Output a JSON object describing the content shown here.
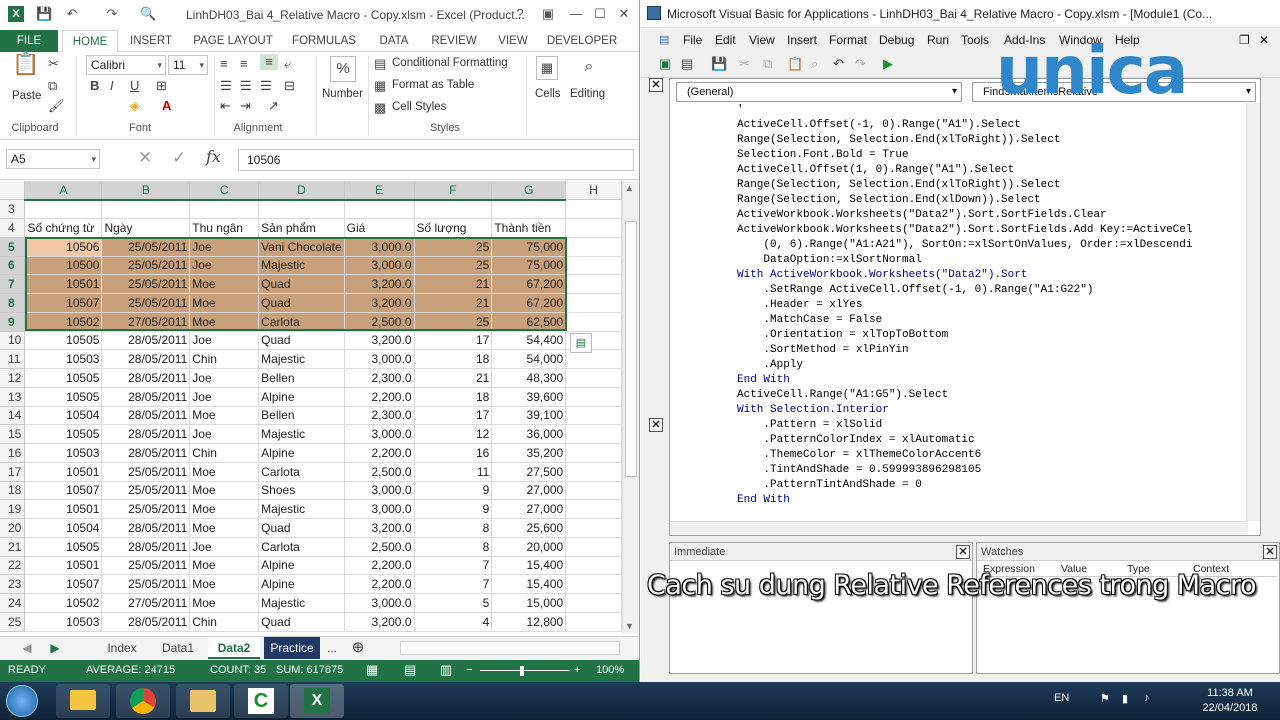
{
  "excel": {
    "title": "LinhDH03_Bai 4_Relative Macro - Copy.xlsm - Excel (Product...",
    "help": "?",
    "tabs": [
      "FILE",
      "HOME",
      "INSERT",
      "PAGE LAYOUT",
      "FORMULAS",
      "DATA",
      "REVIEW",
      "VIEW",
      "DEVELOPER"
    ],
    "ribbon": {
      "paste": "Paste",
      "font_name": "Calibri",
      "font_size": "11",
      "bold": "B",
      "italic": "I",
      "underline": "U",
      "number": "Number",
      "conditional_formatting": "Conditional Formatting",
      "format_as_table": "Format as Table",
      "cell_styles": "Cell Styles",
      "cells": "Cells",
      "editing": "Editing",
      "groups": [
        "Clipboard",
        "Font",
        "Alignment",
        "Styles"
      ]
    },
    "name_box": "A5",
    "formula_value": "10506",
    "fx": "fx",
    "columns": [
      "A",
      "B",
      "C",
      "D",
      "E",
      "F",
      "G",
      "H"
    ],
    "header_row": {
      "row": "4",
      "cells": [
        "Số chứng từ",
        "Ngày",
        "Thu ngân",
        "Sản phẩm",
        "Giá",
        "Số lượng",
        "Thành tiền"
      ]
    },
    "rows": [
      {
        "r": "5",
        "a": "10506",
        "b": "25/05/2011",
        "c": "Joe",
        "d": "Vani Chocolate",
        "e": "3,000.0",
        "f": "25",
        "g": "75,000",
        "hl": true
      },
      {
        "r": "6",
        "a": "10500",
        "b": "25/05/2011",
        "c": "Joe",
        "d": "Majestic",
        "e": "3,000.0",
        "f": "25",
        "g": "75,000",
        "hl": true
      },
      {
        "r": "7",
        "a": "10501",
        "b": "25/05/2011",
        "c": "Moe",
        "d": "Quad",
        "e": "3,200.0",
        "f": "21",
        "g": "67,200",
        "hl": true
      },
      {
        "r": "8",
        "a": "10507",
        "b": "25/05/2011",
        "c": "Moe",
        "d": "Quad",
        "e": "3,200.0",
        "f": "21",
        "g": "67,200",
        "hl": true
      },
      {
        "r": "9",
        "a": "10502",
        "b": "27/05/2011",
        "c": "Moe",
        "d": "Carlota",
        "e": "2,500.0",
        "f": "25",
        "g": "62,500",
        "hl": true
      },
      {
        "r": "10",
        "a": "10505",
        "b": "28/05/2011",
        "c": "Joe",
        "d": "Quad",
        "e": "3,200.0",
        "f": "17",
        "g": "54,400"
      },
      {
        "r": "11",
        "a": "10503",
        "b": "28/05/2011",
        "c": "Chin",
        "d": "Majestic",
        "e": "3,000.0",
        "f": "18",
        "g": "54,000"
      },
      {
        "r": "12",
        "a": "10505",
        "b": "28/05/2011",
        "c": "Joe",
        "d": "Bellen",
        "e": "2,300.0",
        "f": "21",
        "g": "48,300"
      },
      {
        "r": "13",
        "a": "10505",
        "b": "28/05/2011",
        "c": "Joe",
        "d": "Alpine",
        "e": "2,200.0",
        "f": "18",
        "g": "39,600"
      },
      {
        "r": "14",
        "a": "10504",
        "b": "28/05/2011",
        "c": "Moe",
        "d": "Bellen",
        "e": "2,300.0",
        "f": "17",
        "g": "39,100"
      },
      {
        "r": "15",
        "a": "10505",
        "b": "28/05/2011",
        "c": "Joe",
        "d": "Majestic",
        "e": "3,000.0",
        "f": "12",
        "g": "36,000"
      },
      {
        "r": "16",
        "a": "10503",
        "b": "28/05/2011",
        "c": "Chin",
        "d": "Alpine",
        "e": "2,200.0",
        "f": "16",
        "g": "35,200"
      },
      {
        "r": "17",
        "a": "10501",
        "b": "25/05/2011",
        "c": "Moe",
        "d": "Carlota",
        "e": "2,500.0",
        "f": "11",
        "g": "27,500"
      },
      {
        "r": "18",
        "a": "10507",
        "b": "25/05/2011",
        "c": "Moe",
        "d": "Shoes",
        "e": "3,000.0",
        "f": "9",
        "g": "27,000"
      },
      {
        "r": "19",
        "a": "10501",
        "b": "25/05/2011",
        "c": "Moe",
        "d": "Majestic",
        "e": "3,000.0",
        "f": "9",
        "g": "27,000"
      },
      {
        "r": "20",
        "a": "10504",
        "b": "28/05/2011",
        "c": "Moe",
        "d": "Quad",
        "e": "3,200.0",
        "f": "8",
        "g": "25,600"
      },
      {
        "r": "21",
        "a": "10505",
        "b": "28/05/2011",
        "c": "Joe",
        "d": "Carlota",
        "e": "2,500.0",
        "f": "8",
        "g": "20,000"
      },
      {
        "r": "22",
        "a": "10501",
        "b": "25/05/2011",
        "c": "Moe",
        "d": "Alpine",
        "e": "2,200.0",
        "f": "7",
        "g": "15,400"
      },
      {
        "r": "23",
        "a": "10507",
        "b": "25/05/2011",
        "c": "Moe",
        "d": "Alpine",
        "e": "2,200.0",
        "f": "7",
        "g": "15,400"
      },
      {
        "r": "24",
        "a": "10502",
        "b": "27/05/2011",
        "c": "Moe",
        "d": "Majestic",
        "e": "3,000.0",
        "f": "5",
        "g": "15,000"
      },
      {
        "r": "25",
        "a": "10503",
        "b": "28/05/2011",
        "c": "Chin",
        "d": "Quad",
        "e": "3,200.0",
        "f": "4",
        "g": "12,800"
      }
    ],
    "sheets": [
      "Index",
      "Data1",
      "Data2",
      "Practice",
      "..."
    ],
    "active_sheet": "Data2",
    "status": {
      "ready": "READY",
      "average": "AVERAGE: 24715",
      "count": "COUNT: 35",
      "sum": "SUM: 617875",
      "zoom": "100%"
    }
  },
  "vba": {
    "title": "Microsoft Visual Basic for Applications - LinhDH03_Bai 4_Relative Macro - Copy.xlsm - [Module1 (Co...",
    "menu": [
      "File",
      "Edit",
      "View",
      "Insert",
      "Format",
      "Debug",
      "Run",
      "Tools",
      "Add-Ins",
      "Window",
      "Help"
    ],
    "object_combo": "(General)",
    "proc_combo": "Find5MaxItemsRelative",
    "code": [
      "'",
      "ActiveCell.Offset(-1, 0).Range(\"A1\").Select",
      "Range(Selection, Selection.End(xlToRight)).Select",
      "Selection.Font.Bold = True",
      "ActiveCell.Offset(1, 0).Range(\"A1\").Select",
      "Range(Selection, Selection.End(xlToRight)).Select",
      "Range(Selection, Selection.End(xlDown)).Select",
      "ActiveWorkbook.Worksheets(\"Data2\").Sort.SortFields.Clear",
      "ActiveWorkbook.Worksheets(\"Data2\").Sort.SortFields.Add Key:=ActiveCel",
      "    (0, 6).Range(\"A1:A21\"), SortOn:=xlSortOnValues, Order:=xlDescendi",
      "    DataOption:=xlSortNormal",
      "With ActiveWorkbook.Worksheets(\"Data2\").Sort",
      "    .SetRange ActiveCell.Offset(-1, 0).Range(\"A1:G22\")",
      "    .Header = xlYes",
      "    .MatchCase = False",
      "    .Orientation = xlTopToBottom",
      "    .SortMethod = xlPinYin",
      "    .Apply",
      "End With",
      "ActiveCell.Range(\"A1:G5\").Select",
      "With Selection.Interior",
      "    .Pattern = xlSolid",
      "    .PatternColorIndex = xlAutomatic",
      "    .ThemeColor = xlThemeColorAccent6",
      "    .TintAndShade = 0.599993896298105",
      "    .PatternTintAndShade = 0",
      "End With"
    ],
    "immediate_title": "Immediate",
    "watches_title": "Watches",
    "watch_columns": [
      "Expression",
      "Value",
      "Type",
      "Context"
    ]
  },
  "overlay": {
    "caption": "Cach su dung Relative References trong Macro",
    "logo": "unica"
  },
  "taskbar": {
    "lang": "EN",
    "time": "11:38 AM",
    "date": "22/04/2018"
  },
  "colors": {
    "excel_green": "#217346",
    "selection_fill": "#c8a07a",
    "active_cell_fill": "#f2c7a5"
  }
}
